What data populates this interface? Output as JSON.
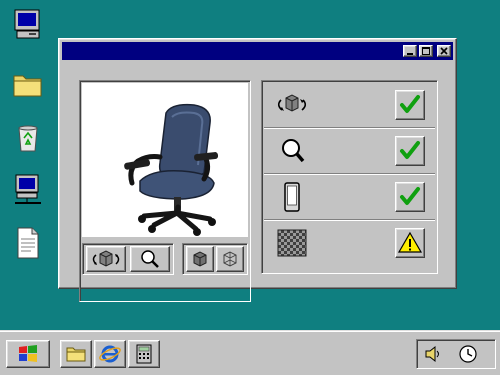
{
  "desktop": {
    "icons": [
      {
        "name": "my-computer-icon"
      },
      {
        "name": "folder-icon"
      },
      {
        "name": "recycle-bin-icon"
      },
      {
        "name": "network-computer-icon"
      },
      {
        "name": "document-icon"
      }
    ]
  },
  "window": {
    "title": "",
    "controls": [
      "minimize-icon",
      "maximize-icon",
      "close-icon"
    ],
    "preview": {
      "subject": "office-chair",
      "tools": [
        "rotate-3d-icon",
        "zoom-icon",
        "solid-cube-icon",
        "wireframe-cube-icon"
      ]
    },
    "properties": [
      {
        "icon": "rotate-3d-icon",
        "status": "check"
      },
      {
        "icon": "magnifier-icon",
        "status": "check"
      },
      {
        "icon": "mobile-phone-icon",
        "status": "check"
      },
      {
        "icon": "transparency-texture-icon",
        "status": "warning"
      }
    ]
  },
  "taskbar": {
    "start_icon": "windows-logo-icon",
    "quick_launch": [
      "folder-icon",
      "internet-explorer-icon",
      "calculator-icon"
    ],
    "tray": [
      "speaker-icon",
      "clock-icon"
    ]
  },
  "colors": {
    "desktop": "#0f7f80",
    "titlebar": "#000080",
    "face": "#c3c3c3",
    "check": "#10a010",
    "warning": "#ffee00"
  }
}
